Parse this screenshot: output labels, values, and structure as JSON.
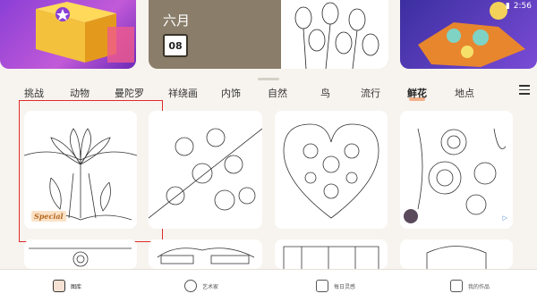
{
  "status": {
    "time": "2:56"
  },
  "banners": [
    {
      "name": "gift-banner"
    },
    {
      "name": "daily-banner",
      "month": "六月",
      "day": "08"
    },
    {
      "name": "food-banner"
    }
  ],
  "tabs": [
    {
      "label": "挑战",
      "active": false
    },
    {
      "label": "动物",
      "active": false
    },
    {
      "label": "曼陀罗",
      "active": false
    },
    {
      "label": "祥绕画",
      "active": false
    },
    {
      "label": "内饰",
      "active": false
    },
    {
      "label": "自然",
      "active": false
    },
    {
      "label": "鸟",
      "active": false
    },
    {
      "label": "流行",
      "active": false
    },
    {
      "label": "鲜花",
      "active": true
    },
    {
      "label": "地点",
      "active": false
    }
  ],
  "cards": [
    {
      "name": "card-lotus",
      "badge": "Special"
    },
    {
      "name": "card-cherry-blossom"
    },
    {
      "name": "card-heart-flowers"
    },
    {
      "name": "card-roses"
    },
    {
      "name": "card-row2-1"
    },
    {
      "name": "card-row2-2"
    },
    {
      "name": "card-row2-3"
    },
    {
      "name": "card-row2-4"
    }
  ],
  "bottom_nav": [
    {
      "label": "图库",
      "icon": "book-icon",
      "active": true
    },
    {
      "label": "艺术家",
      "icon": "cat-icon",
      "active": false
    },
    {
      "label": "每日灵感",
      "icon": "calendar-icon",
      "active": false
    },
    {
      "label": "我的作品",
      "icon": "artwork-icon",
      "active": false
    }
  ]
}
